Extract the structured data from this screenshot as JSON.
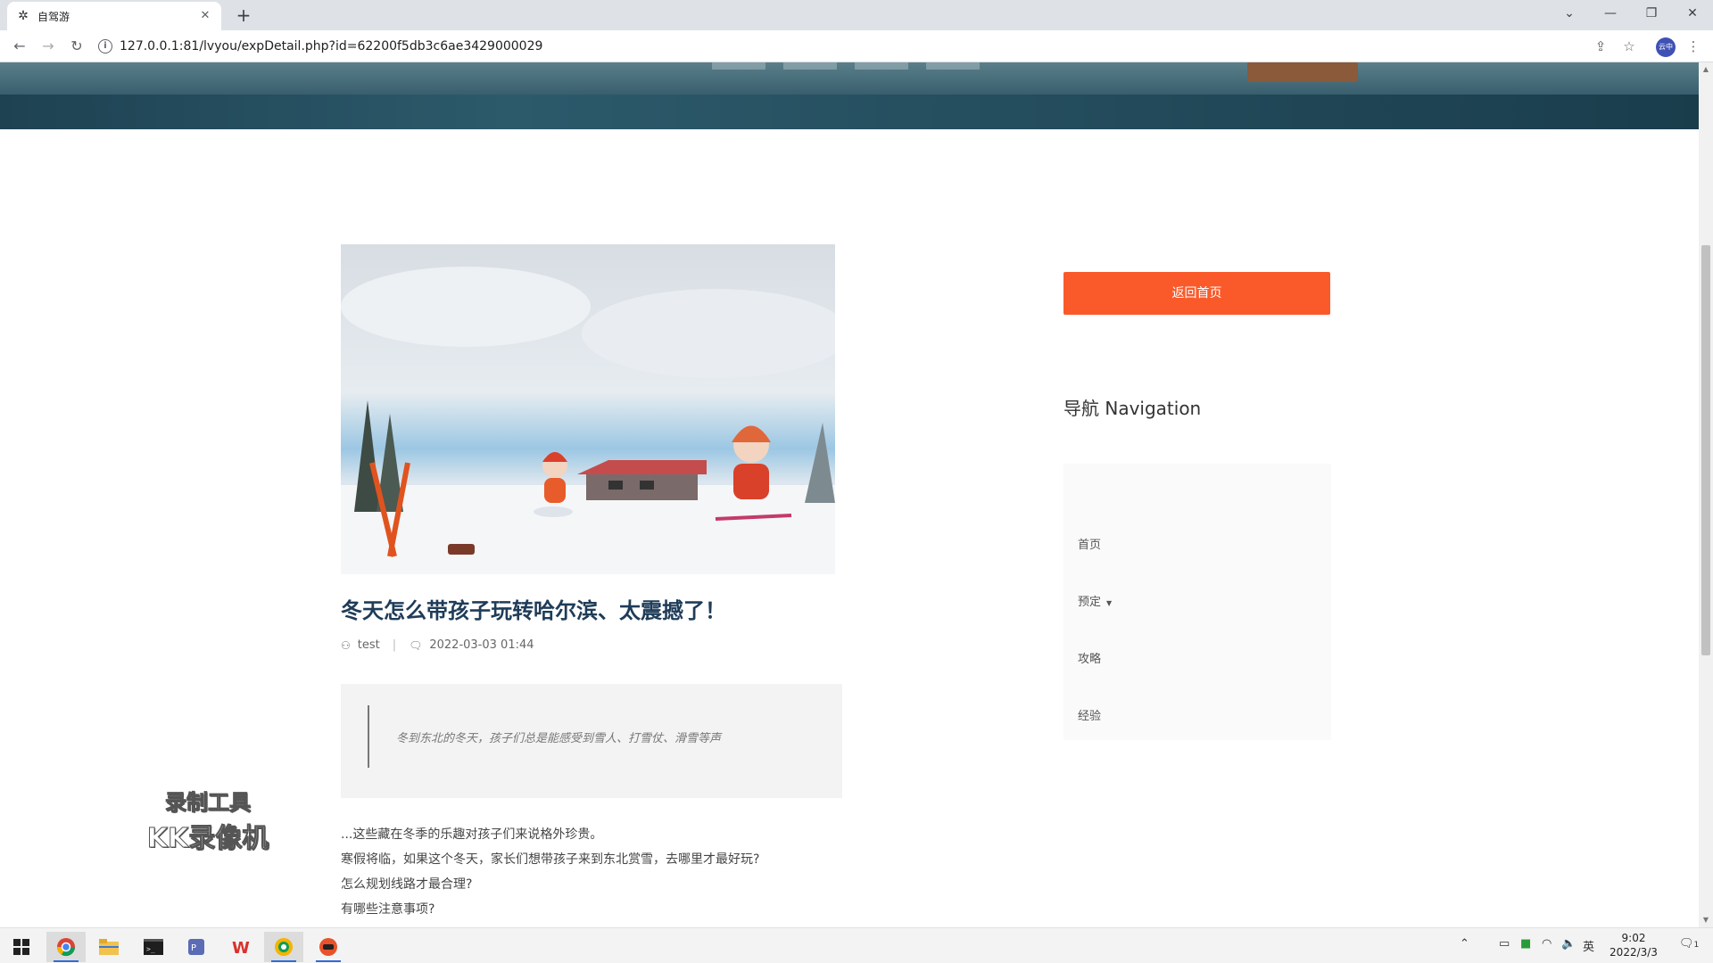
{
  "browser": {
    "tab_title": "自驾游",
    "tab_icon": "gear-icon",
    "url": "127.0.0.1:81/lvyou/expDetail.php?id=62200f5db3c6ae3429000029",
    "profile_label": "云中"
  },
  "page": {
    "article": {
      "title": "冬天怎么带孩子玩转哈尔滨、太震撼了！",
      "author": "test",
      "datetime": "2022-03-03 01:44",
      "quote": "冬到东北的冬天，孩子们总是能感受到雪人、打雪仗、滑雪等声",
      "body": [
        "...这些藏在冬季的乐趣对孩子们来说格外珍贵。",
        "寒假将临，如果这个冬天，家长们想带孩子来到东北赏雪，去哪里才最好玩?",
        "怎么规划线路才最合理?",
        "有哪些注意事项?"
      ]
    },
    "sidebar": {
      "back_button": "返回首页",
      "nav_heading": "导航 Navigation",
      "nav_items": [
        {
          "label": "首页"
        },
        {
          "label": "预定"
        },
        {
          "label": "攻略"
        },
        {
          "label": "经验"
        }
      ]
    },
    "watermark": {
      "line1": "录制工具",
      "line2": "KK录像机"
    }
  },
  "taskbar": {
    "clock_time": "9:02",
    "clock_date": "2022/3/3",
    "ime": "英",
    "notifications": "1"
  },
  "colors": {
    "accent_orange": "#fa5a2a",
    "title_blue": "#1f3c58"
  }
}
